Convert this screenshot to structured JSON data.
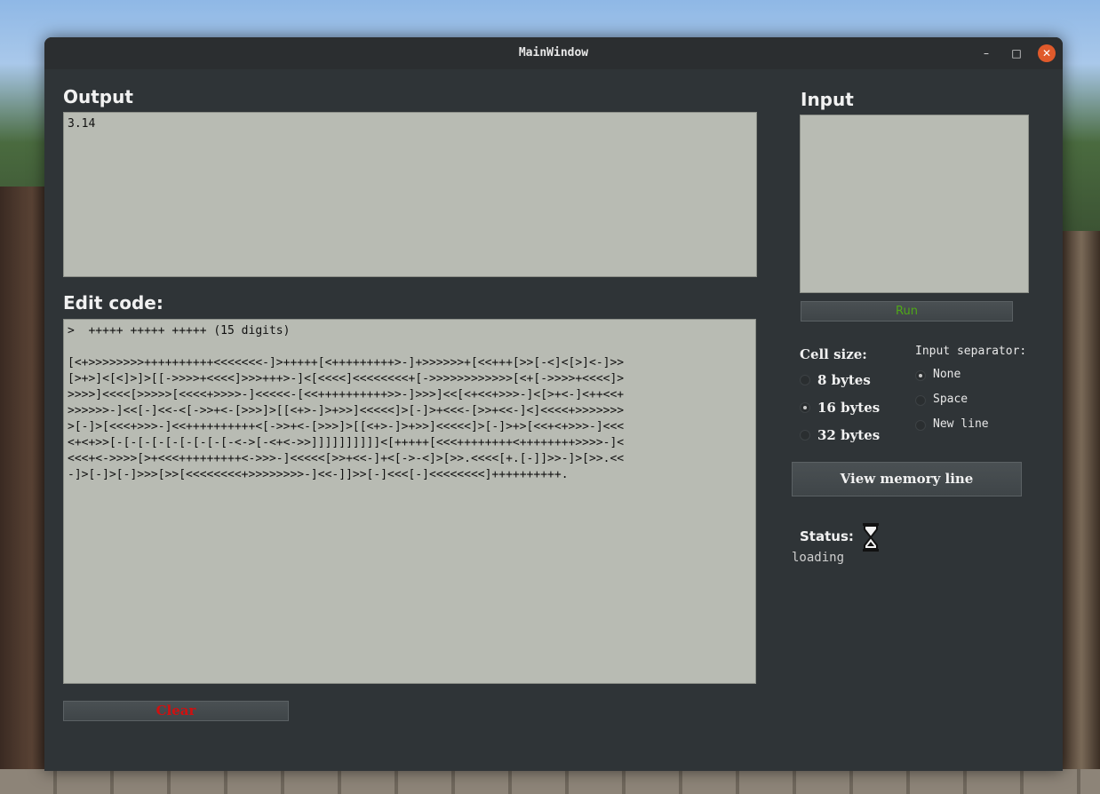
{
  "window": {
    "title": "MainWindow"
  },
  "titlebar": {
    "minimize_glyph": "–",
    "maximize_glyph": "□",
    "close_glyph": "✕"
  },
  "output": {
    "label": "Output",
    "text": "3.14"
  },
  "input": {
    "label": "Input",
    "text": ""
  },
  "editor": {
    "label": "Edit code:",
    "code": ">  +++++ +++++ +++++ (15 digits)\n\n[<+>>>>>>>>++++++++++<<<<<<<-]>+++++[<+++++++++>-]+>>>>>>+[<<+++[>>[-<]<[>]<-]>>\n[>+>]<[<]>]>[[->>>>+<<<<]>>>+++>-]<[<<<<]<<<<<<<<+[->>>>>>>>>>>>[<+[->>>>+<<<<]>\n>>>>]<<<<[>>>>>[<<<<+>>>>-]<<<<<-[<<++++++++++>>-]>>>]<<[<+<<+>>>-]<[>+<-]<++<<+\n>>>>>>-]<<[-]<<-<[->>+<-[>>>]>[[<+>-]>+>>]<<<<<]>[-]>+<<<-[>>+<<-]<]<<<<+>>>>>>>\n>[-]>[<<<+>>>-]<<++++++++++<[->>+<-[>>>]>[[<+>-]>+>>]<<<<<]>[-]>+>[<<+<+>>>-]<<<\n<+<+>>[-[-[-[-[-[-[-[-[-<->[-<+<->>]]]]]]]]]]<[+++++[<<<++++++++<++++++++>>>>-]<\n<<<+<->>>>[>+<<<+++++++++<->>>-]<<<<<[>>+<<-]+<[->-<]>[>>.<<<<[+.[-]]>>-]>[>>.<<\n-]>[-]>[-]>>>[>>[<<<<<<<<+>>>>>>>>-]<<-]]>>[-]<<<[-]<<<<<<<<]++++++++++."
  },
  "run_button": {
    "label": "Run"
  },
  "clear_button": {
    "label": "Clear"
  },
  "cell_size": {
    "label": "Cell size:",
    "options": [
      "8 bytes",
      "16 bytes",
      "32 bytes"
    ],
    "selected": "16 bytes"
  },
  "separator": {
    "label": "Input separator:",
    "options": [
      "None",
      "Space",
      "New line"
    ],
    "selected": "None"
  },
  "view_memory_button": {
    "label": "View memory line"
  },
  "status": {
    "label": "Status:",
    "text": "loading",
    "icon": "hourglass-icon"
  },
  "colors": {
    "window_bg": "#2f3437",
    "textbox_bg": "#b8bbb3",
    "run_text": "#4fa818",
    "clear_text": "#d01010",
    "close_button": "#e05a2b"
  }
}
